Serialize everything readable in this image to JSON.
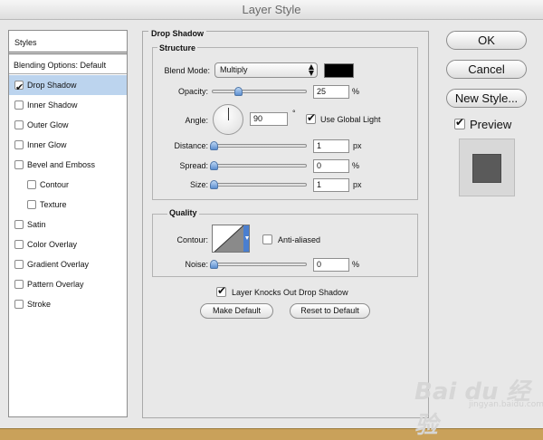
{
  "window": {
    "title": "Layer Style"
  },
  "sidebar": {
    "header": "Styles",
    "blending_options": "Blending Options: Default",
    "items": [
      {
        "label": "Drop Shadow",
        "checked": true,
        "selected": true
      },
      {
        "label": "Inner Shadow",
        "checked": false
      },
      {
        "label": "Outer Glow",
        "checked": false
      },
      {
        "label": "Inner Glow",
        "checked": false
      },
      {
        "label": "Bevel and Emboss",
        "checked": false
      },
      {
        "label": "Contour",
        "checked": false
      },
      {
        "label": "Texture",
        "checked": false
      },
      {
        "label": "Satin",
        "checked": false
      },
      {
        "label": "Color Overlay",
        "checked": false
      },
      {
        "label": "Gradient Overlay",
        "checked": false
      },
      {
        "label": "Pattern Overlay",
        "checked": false
      },
      {
        "label": "Stroke",
        "checked": false
      }
    ]
  },
  "panel": {
    "title": "Drop Shadow",
    "structure": {
      "title": "Structure",
      "blend_mode_label": "Blend Mode:",
      "blend_mode_value": "Multiply",
      "shadow_color": "#000000",
      "opacity_label": "Opacity:",
      "opacity_value": "25",
      "opacity_unit": "%",
      "angle_label": "Angle:",
      "angle_value": "90",
      "angle_unit": "°",
      "use_global_light_label": "Use Global Light",
      "use_global_light_checked": true,
      "distance_label": "Distance:",
      "distance_value": "1",
      "distance_unit": "px",
      "spread_label": "Spread:",
      "spread_value": "0",
      "spread_unit": "%",
      "size_label": "Size:",
      "size_value": "1",
      "size_unit": "px"
    },
    "quality": {
      "title": "Quality",
      "contour_label": "Contour:",
      "anti_aliased_label": "Anti-aliased",
      "anti_aliased_checked": false,
      "noise_label": "Noise:",
      "noise_value": "0",
      "noise_unit": "%"
    },
    "knocks_out_label": "Layer Knocks Out Drop Shadow",
    "knocks_out_checked": true,
    "make_default_label": "Make Default",
    "reset_default_label": "Reset to Default"
  },
  "actions": {
    "ok_label": "OK",
    "cancel_label": "Cancel",
    "new_style_label": "New Style...",
    "preview_label": "Preview",
    "preview_checked": true
  },
  "watermark": {
    "text": "Bai du 经验",
    "sub": "jingyan.baidu.com"
  }
}
